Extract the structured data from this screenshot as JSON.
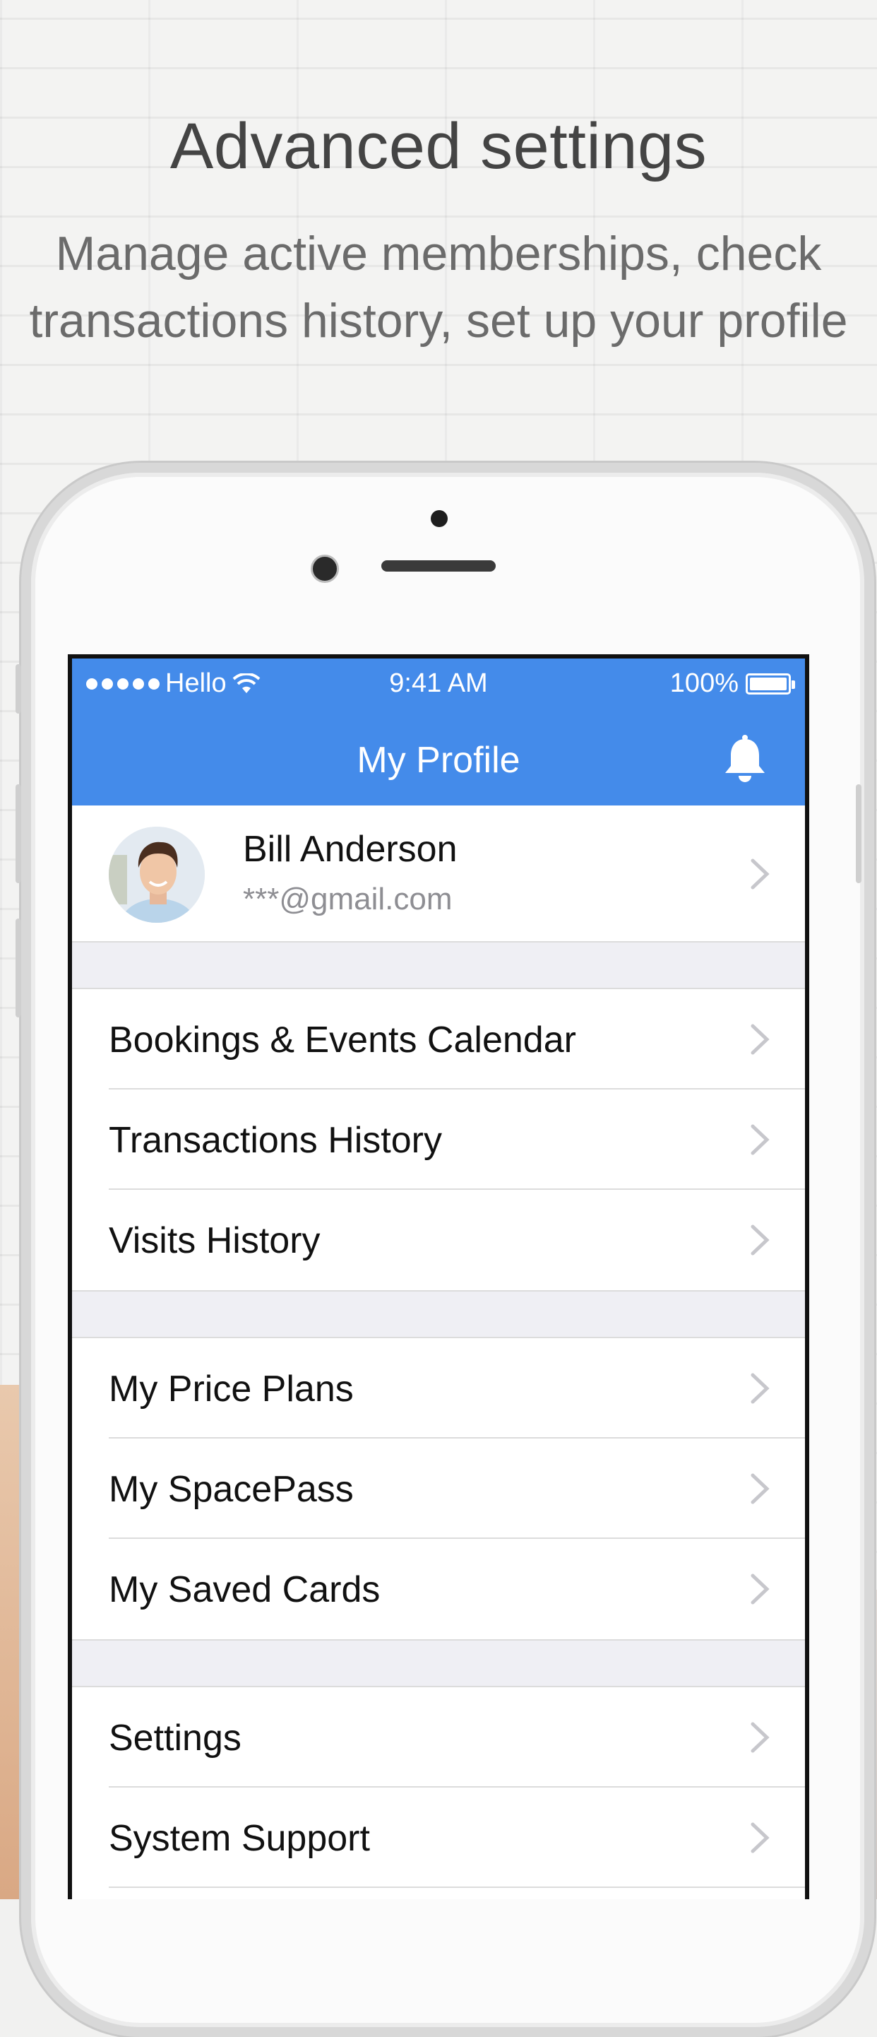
{
  "hero": {
    "title": "Advanced settings",
    "subtitle": "Manage active memberships, check transactions history, set up your profile"
  },
  "status_bar": {
    "carrier": "Hello",
    "time": "9:41 AM",
    "battery": "100%"
  },
  "nav": {
    "title": "My Profile",
    "notification_icon": "bell-icon"
  },
  "profile": {
    "name": "Bill Anderson",
    "email": "***@gmail.com"
  },
  "menu_groups": [
    {
      "items": [
        "Bookings & Events Calendar",
        "Transactions History",
        "Visits History"
      ]
    },
    {
      "items": [
        "My Price Plans",
        "My SpacePass",
        "My Saved Cards"
      ]
    },
    {
      "items": [
        "Settings",
        "System Support"
      ]
    }
  ],
  "colors": {
    "accent": "#448bea",
    "group_gap": "#efeff4",
    "chevron": "#c7c7cc"
  }
}
